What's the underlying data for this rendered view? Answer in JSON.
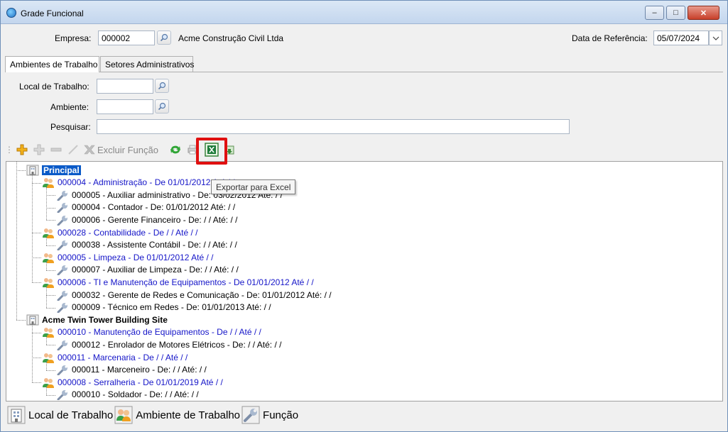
{
  "window": {
    "title": "Grade Funcional"
  },
  "header": {
    "empresa_label": "Empresa:",
    "empresa_code": "000002",
    "empresa_name": "Acme Construção Civil Ltda",
    "data_ref_label": "Data de Referência:",
    "data_ref_value": "05/07/2024"
  },
  "tabs": [
    "Ambientes de Trabalho",
    "Setores Administrativos"
  ],
  "filters": {
    "local_label": "Local de Trabalho:",
    "ambiente_label": "Ambiente:",
    "pesquisar_label": "Pesquisar:"
  },
  "toolbar": {
    "excluir_label": "Excluir Função",
    "tooltip": "Exportar para Excel"
  },
  "tree": [
    {
      "level": 0,
      "type": "local",
      "text": "Principal",
      "selected": true
    },
    {
      "level": 1,
      "type": "ambiente",
      "text": "000004 - Administração - De 01/01/2012 Até  /  /"
    },
    {
      "level": 2,
      "type": "funcao",
      "text": "000005 - Auxiliar administrativo - De: 03/02/2012 Até:  /  /"
    },
    {
      "level": 2,
      "type": "funcao",
      "text": "000004 - Contador - De: 01/01/2012 Até:  /  /"
    },
    {
      "level": 2,
      "type": "funcao",
      "text": "000006 - Gerente Financeiro - De:  /  /     Até:  /  /"
    },
    {
      "level": 1,
      "type": "ambiente",
      "text": "000028 - Contabilidade - De   /  /      Até   /  /"
    },
    {
      "level": 2,
      "type": "funcao",
      "text": "000038 - Assistente Contábil - De:  /  /     Até:  /  /"
    },
    {
      "level": 1,
      "type": "ambiente",
      "text": "000005 - Limpeza - De 01/01/2012 Até   /  /"
    },
    {
      "level": 2,
      "type": "funcao",
      "text": "000007 - Auxiliar de Limpeza - De:  /  /     Até:  /  /"
    },
    {
      "level": 1,
      "type": "ambiente",
      "text": "000006 - TI e Manutenção de Equipamentos - De 01/01/2012 Até   /  /"
    },
    {
      "level": 2,
      "type": "funcao",
      "text": "000032 - Gerente de Redes e Comunicação - De: 01/01/2012 Até:  /  /"
    },
    {
      "level": 2,
      "type": "funcao",
      "text": "000009 - Técnico em Redes - De: 01/01/2013 Até:  /  /"
    },
    {
      "level": 0,
      "type": "local",
      "text": "Acme Twin Tower Building Site",
      "selected": false
    },
    {
      "level": 1,
      "type": "ambiente",
      "text": "000010 - Manutenção de Equipamentos - De   /  /      Até   /  /"
    },
    {
      "level": 2,
      "type": "funcao",
      "text": "000012 - Enrolador de Motores Elétricos - De:  /  /     Até:  /  /"
    },
    {
      "level": 1,
      "type": "ambiente",
      "text": "000011 - Marcenaria - De   /  /      Até   /  /"
    },
    {
      "level": 2,
      "type": "funcao",
      "text": "000011 - Marceneiro - De:  /  /     Até:  /  /"
    },
    {
      "level": 1,
      "type": "ambiente",
      "text": "000008 - Serralheria - De 01/01/2019 Até   /  /"
    },
    {
      "level": 2,
      "type": "funcao",
      "text": "000010 - Soldador - De:  /  /     Até:  /  /"
    }
  ],
  "legend": {
    "local": "Local de Trabalho",
    "ambiente": "Ambiente de Trabalho",
    "funcao": "Função"
  }
}
